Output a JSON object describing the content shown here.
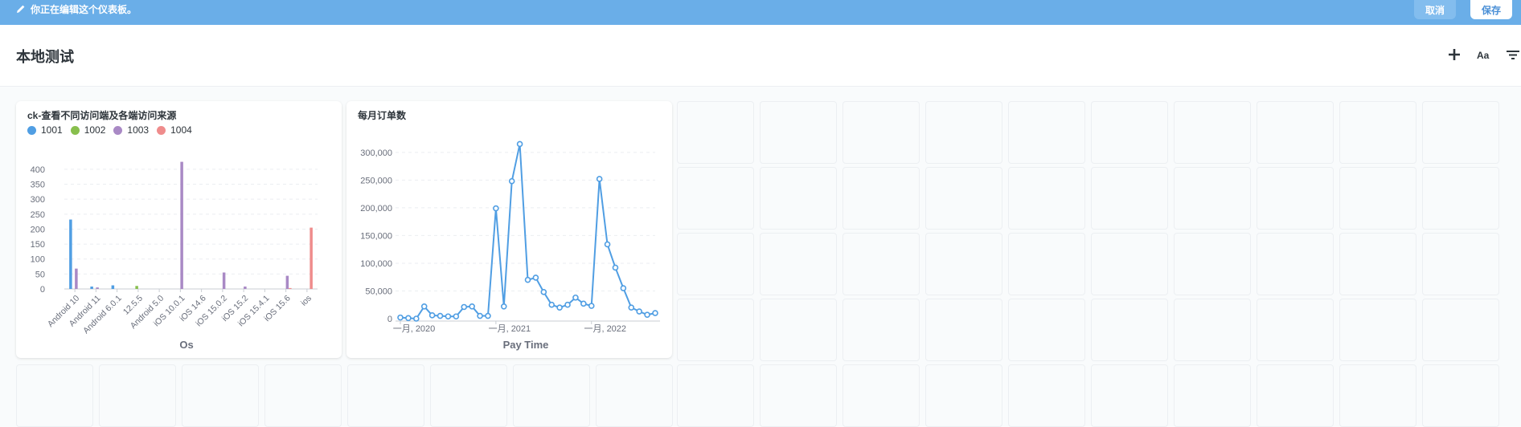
{
  "edit_bar": {
    "message": "你正在编辑这个仪表板。",
    "cancel_label": "取消",
    "save_label": "保存"
  },
  "dashboard": {
    "title": "本地测试",
    "text_tool_label": "Aa",
    "icons": [
      "plus-icon",
      "text-icon",
      "filter-icon"
    ]
  },
  "card1": {
    "title": "ck-查看不同访问端及各端访问来源",
    "chart_data": {
      "type": "bar",
      "title": "ck-查看不同访问端及各端访问来源",
      "xlabel": "Os",
      "ylabel": "",
      "ylim": [
        0,
        440
      ],
      "yticks": [
        0,
        50,
        100,
        150,
        200,
        250,
        300,
        350,
        400
      ],
      "categories": [
        "Android 10",
        "Android 11",
        "Android 6.0.1",
        "12.5.5",
        "Android 5.0",
        "iOS 10.0.1",
        "iOS 14.6",
        "iOS 15.0.2",
        "iOS 15.2",
        "iOS 15.4.1",
        "iOS 15.6",
        "ios"
      ],
      "series": [
        {
          "name": "1001",
          "color": "#509ee3",
          "values": [
            232,
            8,
            12,
            0,
            0,
            0,
            0,
            0,
            0,
            0,
            0,
            0
          ]
        },
        {
          "name": "1002",
          "color": "#88bf4d",
          "values": [
            0,
            0,
            0,
            10,
            0,
            0,
            0,
            0,
            0,
            0,
            0,
            0
          ]
        },
        {
          "name": "1003",
          "color": "#a989c5",
          "values": [
            68,
            5,
            0,
            0,
            0,
            425,
            0,
            55,
            8,
            0,
            44,
            0
          ]
        },
        {
          "name": "1004",
          "color": "#ef8c8c",
          "values": [
            0,
            0,
            0,
            0,
            0,
            0,
            0,
            0,
            0,
            0,
            3,
            205
          ]
        }
      ]
    }
  },
  "card2": {
    "title": "每月订单数",
    "chart_data": {
      "type": "line",
      "title": "每月订单数",
      "xlabel": "Pay Time",
      "ylabel": "",
      "ylim": [
        0,
        320000
      ],
      "yticks": [
        0,
        50000,
        100000,
        150000,
        200000,
        250000,
        300000
      ],
      "ytick_labels": [
        "0",
        "50,000",
        "100,000",
        "150,000",
        "200,000",
        "250,000",
        "300,000"
      ],
      "xtick_labels": [
        "一月, 2020",
        "一月, 2021",
        "一月, 2022"
      ],
      "series": [
        {
          "color": "#509ee3",
          "x": [
            "2020-01",
            "2020-02",
            "2020-03",
            "2020-04",
            "2020-05",
            "2020-06",
            "2020-07",
            "2020-08",
            "2020-09",
            "2020-10",
            "2020-11",
            "2020-12",
            "2021-01",
            "2021-02",
            "2021-03",
            "2021-04",
            "2021-05",
            "2021-06",
            "2021-07",
            "2021-08",
            "2021-09",
            "2021-10",
            "2021-11",
            "2021-12",
            "2022-01",
            "2022-02",
            "2022-03",
            "2022-04",
            "2022-05",
            "2022-06",
            "2022-07",
            "2022-08",
            "2022-09"
          ],
          "values": [
            2000,
            1000,
            0,
            22000,
            6000,
            5000,
            4000,
            4000,
            21000,
            22000,
            5000,
            5000,
            199000,
            22000,
            248000,
            315000,
            70000,
            74000,
            48000,
            25000,
            20000,
            25000,
            38000,
            27000,
            23000,
            252000,
            134000,
            92000,
            55000,
            20000,
            13000,
            7000,
            10000
          ]
        }
      ]
    }
  }
}
